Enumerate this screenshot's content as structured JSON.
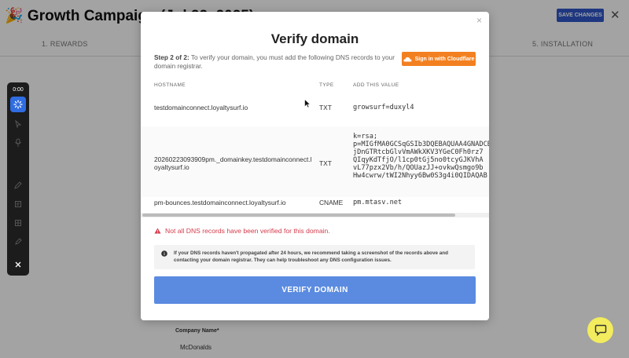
{
  "app": {
    "title": "🎉 Growth Campaign (Jul 22, 2025)",
    "save_label": "SAVE CHANGES",
    "close_glyph": "✕",
    "steps": [
      "1. REWARDS",
      "5. INSTALLATION"
    ]
  },
  "recorder": {
    "time": "0:00",
    "tools": [
      "spinner-icon",
      "cursor-icon",
      "microphone-icon",
      "pen-icon",
      "note-icon",
      "grid-icon",
      "marker-icon",
      "close-icon"
    ]
  },
  "background_form": {
    "company_label": "Company Name*",
    "company_value": "McDonalds"
  },
  "modal": {
    "close_glyph": "×",
    "title": "Verify domain",
    "step_label": "Step 2 of 2:",
    "intro": " To verify your domain, you must add the following DNS records to your domain registrar.",
    "cloudflare_button": "Sign in with Cloudflare",
    "table": {
      "headers": {
        "hostname": "HOSTNAME",
        "type": "TYPE",
        "value": "ADD THIS VALUE"
      },
      "rows": [
        {
          "hostname": "testdomainconnect.loyaltysurf.io",
          "type": "TXT",
          "value": "growsurf=duxyl4"
        },
        {
          "hostname": "20260223093909pm._domainkey.testdomainconnect.loyaltysurf.io",
          "type": "TXT",
          "value": "k=rsa;\np=MIGfMA0GCSqGSIb3DQEBAQUAA4GNADCBiQKBgQDKD+t8lBtxPRLkF5u2H76BT5uGTzL\njDnGTRtcbGlvVmAWkXKV3YGeC0Fh0rz7\nQIqyKdTfjO/l1cp0tGj5no0tcyGJKVhA\nvL77pzx2Vb/h/QOUazJJ+ovkwQsmgo9b\nHw4cwrw/tWI2Nhyy6Bw0S3g4i0QIDAQAB"
        },
        {
          "hostname": "pm-bounces.testdomainconnect.loyaltysurf.io",
          "type": "CNAME",
          "value": "pm.mtasv.net"
        }
      ]
    },
    "warning": "Not all DNS records have been verified for this domain.",
    "info": "If your DNS records haven't propagated after 24 hours, we recommend taking a screenshot of the records above and contacting your domain registrar. They can help troubleshoot any DNS configuration issues.",
    "verify_button": "VERIFY DOMAIN"
  },
  "colors": {
    "cloudflare": "#f38020",
    "verify": "#5b8be0",
    "warning": "#d43c4c",
    "save": "#2f56c9",
    "help": "#f2ec5e"
  }
}
